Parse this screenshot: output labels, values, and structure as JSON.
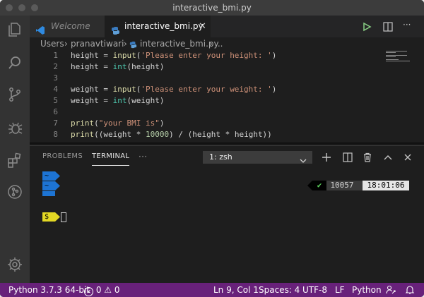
{
  "window": {
    "title": "interactive_bmi.py"
  },
  "tabs": [
    {
      "label": "Welcome"
    },
    {
      "label": "interactive_bmi.py"
    }
  ],
  "breadcrumb": [
    "Users",
    "pranavtiwari",
    "interactive_bmi.py",
    "..."
  ],
  "editor": {
    "lines": [
      {
        "n": "1",
        "parts": [
          [
            "",
            "height = "
          ],
          [
            "fn",
            "input"
          ],
          [
            "",
            "("
          ],
          [
            "str",
            "'Please enter your height: '"
          ],
          [
            "",
            ")"
          ]
        ]
      },
      {
        "n": "2",
        "parts": [
          [
            "",
            "height = "
          ],
          [
            "bi",
            "int"
          ],
          [
            "",
            "(height)"
          ]
        ]
      },
      {
        "n": "3",
        "parts": []
      },
      {
        "n": "4",
        "parts": [
          [
            "",
            "weight = "
          ],
          [
            "fn",
            "input"
          ],
          [
            "",
            "("
          ],
          [
            "str",
            "'Please enter your weight: '"
          ],
          [
            "",
            ")"
          ]
        ]
      },
      {
        "n": "5",
        "parts": [
          [
            "",
            "weight = "
          ],
          [
            "bi",
            "int"
          ],
          [
            "",
            "(weight)"
          ]
        ]
      },
      {
        "n": "6",
        "parts": []
      },
      {
        "n": "7",
        "parts": [
          [
            "fn",
            "print"
          ],
          [
            "",
            "("
          ],
          [
            "str",
            "\"your BMI is\""
          ],
          [
            "",
            ")"
          ]
        ]
      },
      {
        "n": "8",
        "parts": [
          [
            "fn",
            "print"
          ],
          [
            "",
            "((weight * "
          ],
          [
            "num",
            "10000"
          ],
          [
            "",
            ") / (height * height))"
          ]
        ]
      }
    ]
  },
  "panel": {
    "tabs": [
      "PROBLEMS",
      "TERMINAL"
    ],
    "more": "···",
    "shell": "1: zsh"
  },
  "terminal": {
    "prompt_segments": [
      "~",
      "~",
      "$"
    ],
    "right_check": "✔",
    "right_count": "10057",
    "right_time": "18:01:06"
  },
  "status": {
    "python": "Python 3.7.3 64-bit",
    "errors": "0",
    "warnings": "0",
    "position": "Ln 9, Col 1",
    "spaces": "Spaces: 4",
    "encoding": "UTF-8",
    "eol": "LF",
    "language": "Python"
  },
  "colors": {
    "status_bg": "#68217a",
    "prompt_blue": "#1d74d4",
    "prompt_yellow": "#e3d824"
  }
}
